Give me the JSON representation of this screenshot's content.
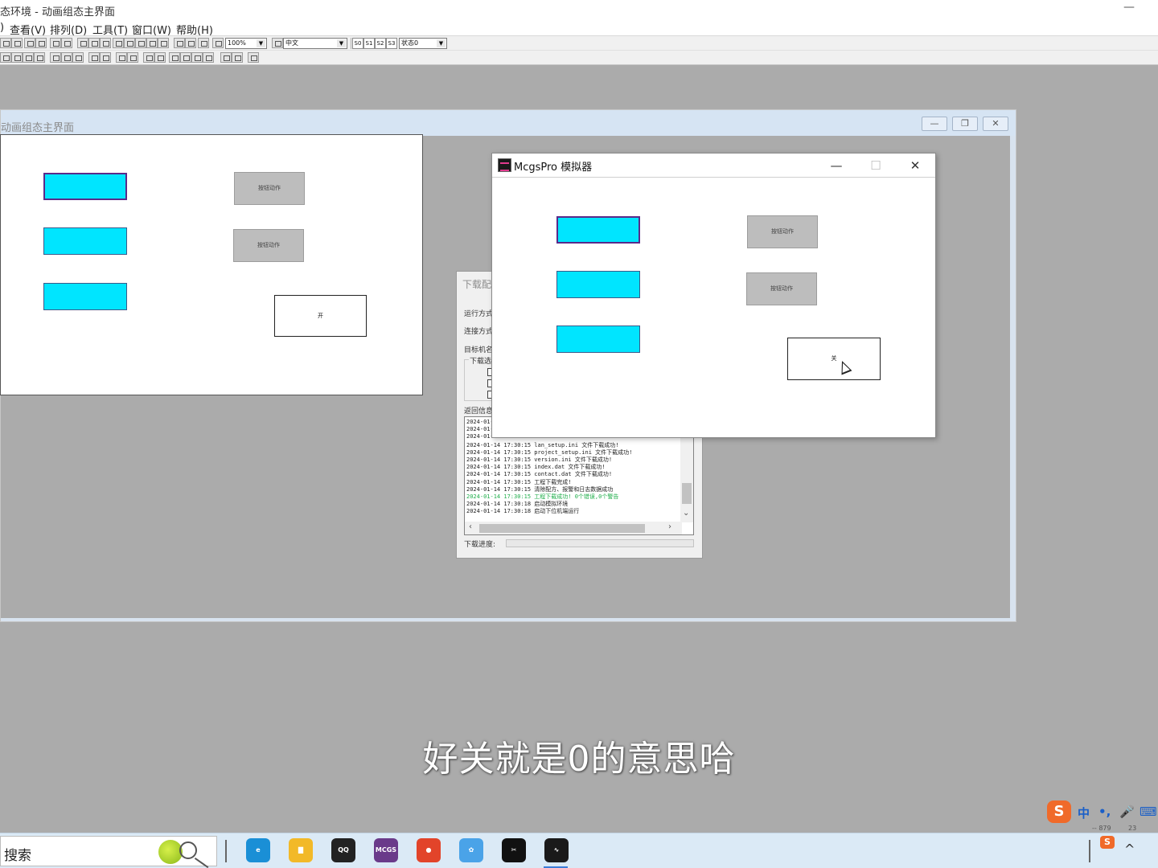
{
  "app": {
    "title": "态环境 - 动画组态主界面",
    "minimize_glyph": "—"
  },
  "menu": [
    ")",
    "查看(V)",
    "排列(D)",
    "工具(T)",
    "窗口(W)",
    "帮助(H)"
  ],
  "toolbar": {
    "zoom_value": "100%",
    "font_value": "中文",
    "state_buttons": [
      "S0",
      "S1",
      "S2",
      "S3"
    ],
    "state_value": "状态0",
    "combo_arrow": "▼"
  },
  "editor_window": {
    "title": "动画组态主界面",
    "min_glyph": "—",
    "restore_glyph": "❐",
    "close_glyph": "✕",
    "button_a_label": "按钮动作",
    "button_b_label": "按钮动作",
    "lamp_label": "开"
  },
  "download_dialog": {
    "title": "下载配",
    "run_mode_label": "运行方式",
    "connect_mode_label": "连接方式",
    "target_label": "目标机名",
    "options_label": "下载选项",
    "return_info_label": "返回信息",
    "log": [
      {
        "text": "2024-01-",
        "green": false
      },
      {
        "text": "2024-01-",
        "green": false
      },
      {
        "text": "2024-01-",
        "green": false
      },
      {
        "text": "2024-01-14 17:30:15   lan_setup.ini 文件下载成功!",
        "green": false
      },
      {
        "text": "2024-01-14 17:30:15   project_setup.ini 文件下载成功!",
        "green": false
      },
      {
        "text": "2024-01-14 17:30:15   version.ini 文件下载成功!",
        "green": false
      },
      {
        "text": "2024-01-14 17:30:15   index.dat 文件下载成功!",
        "green": false
      },
      {
        "text": "2024-01-14 17:30:15   contact.dat 文件下载成功!",
        "green": false
      },
      {
        "text": "2024-01-14 17:30:15   工程下载完成!",
        "green": false
      },
      {
        "text": "2024-01-14 17:30:15   清除配方、报警和日志数据成功",
        "green": false
      },
      {
        "text": "2024-01-14 17:30:15   工程下载成功! 0个错误,0个警告",
        "green": true
      },
      {
        "text": "2024-01-14 17:30:18   启动模拟环境",
        "green": false
      },
      {
        "text": "2024-01-14 17:30:18   启动下位机端运行",
        "green": false
      }
    ],
    "scroll_left": "‹",
    "scroll_right": "›",
    "scroll_down": "⌄",
    "progress_label": "下载进度:"
  },
  "simulator": {
    "title": "McgsPro 模拟器",
    "min_glyph": "—",
    "max_glyph": "☐",
    "close_glyph": "✕",
    "button_a_label": "按钮动作",
    "button_b_label": "按钮动作",
    "lamp_label": "关"
  },
  "subtitle": "好关就是0的意思哈",
  "ime": {
    "logo": "S",
    "lang": "中",
    "punct": "•,",
    "mic_glyph": "🎤",
    "keyboard_glyph": "⌨"
  },
  "status_numbers": {
    "left": "-- 879",
    "right": "23"
  },
  "taskbar": {
    "search_text": "搜索",
    "apps": [
      {
        "name": "edge-icon",
        "label": "e",
        "color": "#1a8fd6"
      },
      {
        "name": "file-explorer-icon",
        "label": "▇",
        "color": "#f2b928"
      },
      {
        "name": "qq-icon",
        "label": "QQ",
        "color": "#222222"
      },
      {
        "name": "mcgs-icon",
        "label": "MCGS",
        "color": "#6a3a8a"
      },
      {
        "name": "record-icon",
        "label": "●",
        "color": "#e2442a"
      },
      {
        "name": "cloud-icon",
        "label": "✿",
        "color": "#4aa3e8"
      },
      {
        "name": "capcut-icon",
        "label": "✂",
        "color": "#111111"
      },
      {
        "name": "mcgs-sim-icon",
        "label": "∿",
        "color": "#1a1a1a"
      }
    ],
    "tray_arrow": "^",
    "tray_s": "S"
  }
}
